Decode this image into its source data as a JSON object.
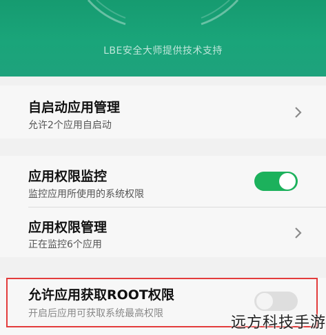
{
  "header": {
    "support_text": "LBE安全大师提供技术支持"
  },
  "settings": [
    {
      "title": "自启动应用管理",
      "subtitle": "允许2个应用自启动",
      "control": "chevron"
    },
    {
      "title": "应用权限监控",
      "subtitle": "监控应用所使用的系统权限",
      "control": "toggle",
      "on": true
    },
    {
      "title": "应用权限管理",
      "subtitle": "正在监控6个应用",
      "control": "chevron"
    },
    {
      "title": "允许应用获取ROOT权限",
      "subtitle": "开启后应用可获取系统最高权限",
      "control": "toggle",
      "on": false
    }
  ],
  "colors": {
    "accent": "#1aa57a",
    "toggle_on": "#1cb15c",
    "toggle_off": "#dedede",
    "highlight": "#e33b3b"
  },
  "watermark": "远方科技手游"
}
